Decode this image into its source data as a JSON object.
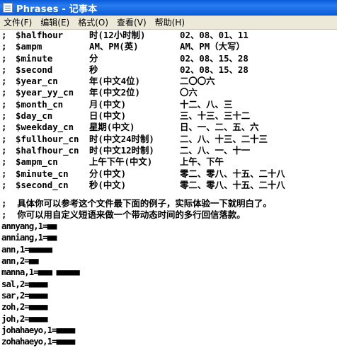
{
  "window": {
    "title": "Phrases - 记事本"
  },
  "menu": [
    "文件(F)",
    "编辑(E)",
    "格式(O)",
    "查看(V)",
    "帮助(H)"
  ],
  "rows": [
    {
      "prefix": ";",
      "name": "$halfhour",
      "desc": "时(12小时制)",
      "example": "02、08、01、11"
    },
    {
      "prefix": ";",
      "name": "$ampm",
      "desc": "AM、PM(英)",
      "example": "AM、PM（大写）"
    },
    {
      "prefix": ";",
      "name": "$minute",
      "desc": "分",
      "example": "02、08、15、28"
    },
    {
      "prefix": ";",
      "name": "$second",
      "desc": "秒",
      "example": "02、08、15、28"
    },
    {
      "prefix": ";",
      "name": "$year_cn",
      "desc": "年(中文4位)",
      "example": "二〇〇六"
    },
    {
      "prefix": ";",
      "name": "$year_yy_cn",
      "desc": "年(中文2位)",
      "example": "〇六"
    },
    {
      "prefix": ";",
      "name": "$month_cn",
      "desc": "月(中文)",
      "example": "十二、八、三"
    },
    {
      "prefix": ";",
      "name": "$day_cn",
      "desc": "日(中文)",
      "example": "三、十三、三十二"
    },
    {
      "prefix": ";",
      "name": "$weekday_cn",
      "desc": "星期(中文)",
      "example": "日、一、二、五、六"
    },
    {
      "prefix": ";",
      "name": "$fullhour_cn",
      "desc": "时(中文24时制)",
      "example": "二、八、十三、二十三"
    },
    {
      "prefix": ";",
      "name": "$halfhour_cn",
      "desc": "时(中文12时制)",
      "example": "二、八、一、十一"
    },
    {
      "prefix": ";",
      "name": "$ampm_cn",
      "desc": "上午下午(中文)",
      "example": "上午、下午"
    },
    {
      "prefix": ";",
      "name": "$minute_cn",
      "desc": "分(中文)",
      "example": "零二、零八、十五、二十八"
    },
    {
      "prefix": ";",
      "name": "$second_cn",
      "desc": "秒(中文)",
      "example": "零二、零八、十五、二十八"
    }
  ],
  "notes": [
    ";  具体你可以参考这个文件最下面的例子，实际体验一下就明白了。",
    ";  你可以用自定义短语来做一个带动态时间的多行回信落款。"
  ],
  "entries": [
    "annyang,1=■■",
    "anniang,1=■■",
    "ann,1=■■■■■",
    "ann,2=■■",
    "manna,1=■■■ ■■■■■",
    "sal,2=■■■■",
    "sar,2=■■■■",
    "zoh,2=■■■■",
    "joh,2=■■■■",
    "johahaeyo,1=■■■■",
    "zohahaeyo,1=■■■■"
  ]
}
